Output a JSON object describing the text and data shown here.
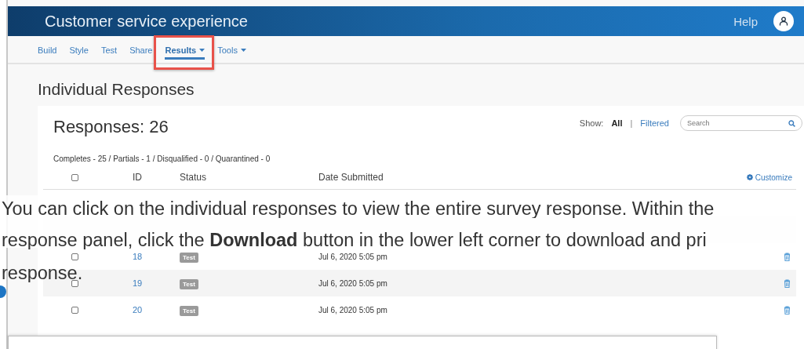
{
  "header": {
    "title": "Customer service experience",
    "help": "Help"
  },
  "nav": [
    {
      "label": "Build",
      "selected": false,
      "dropdown": false,
      "highlighted": false
    },
    {
      "label": "Style",
      "selected": false,
      "dropdown": false,
      "highlighted": false
    },
    {
      "label": "Test",
      "selected": false,
      "dropdown": false,
      "highlighted": false
    },
    {
      "label": "Share",
      "selected": false,
      "dropdown": false,
      "highlighted": false
    },
    {
      "label": "Results",
      "selected": true,
      "dropdown": true,
      "highlighted": true
    },
    {
      "label": "Tools",
      "selected": false,
      "dropdown": true,
      "highlighted": false
    }
  ],
  "page_title": "Individual Responses",
  "responses": {
    "count_label": "Responses: 26",
    "show_label": "Show:",
    "filters": [
      {
        "label": "All",
        "selected": true
      },
      {
        "label": "Filtered",
        "selected": false
      }
    ],
    "separator": "|",
    "search": {
      "placeholder": "Search"
    },
    "summary": "Completes - 25 / Partials - 1 / Disqualified - 0 / Quarantined - 0",
    "select_all": {
      "checked": false
    },
    "columns": [
      "ID",
      "Status",
      "Date Submitted"
    ],
    "customize": "Customize",
    "rows": [
      {
        "kind": "covered"
      },
      {
        "kind": "covered"
      },
      {
        "kind": "response",
        "id": "18",
        "status": "Test",
        "date": "Jul 6, 2020 5:05 pm",
        "checked": false
      },
      {
        "kind": "response",
        "id": "19",
        "status": "Test",
        "date": "Jul 6, 2020 5:05 pm",
        "checked": false
      },
      {
        "kind": "response",
        "id": "20",
        "status": "Test",
        "date": "Jul 6, 2020 5:05 pm",
        "checked": false
      }
    ]
  },
  "caption": {
    "lines": [
      "You can click on the individual responses to view the entire survey response. Within the",
      "response panel, click the **Download** button in the lower left corner to download and pri",
      "response."
    ]
  }
}
